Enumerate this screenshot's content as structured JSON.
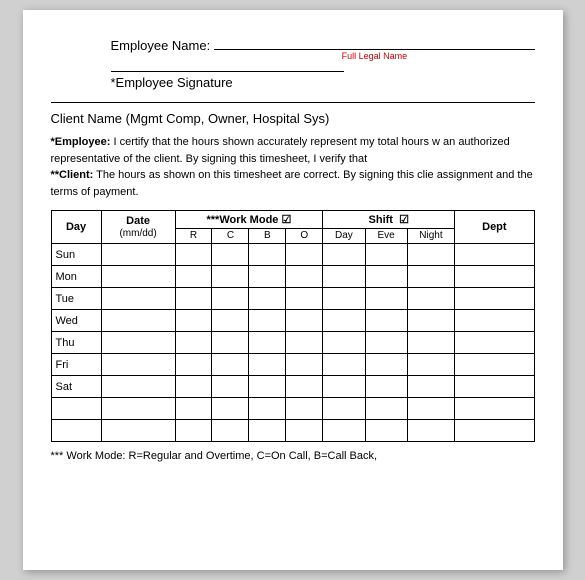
{
  "header": {
    "employee_name_label": "Employee Name:",
    "full_legal_name": "Full Legal Name",
    "employee_signature_label": "*Employee Signature",
    "client_name": "Client Name (Mgmt Comp, Owner, Hospital Sys)"
  },
  "cert_text": {
    "employee_line": "*Employee:  I certify that the hours shown accurately represent my total hours w an authorized representative of the client. By signing this timesheet, I verify that",
    "client_line": "**Client:  The hours as shown on this timesheet are correct.  By signing this clie assignment and the terms of payment."
  },
  "table": {
    "headers": {
      "day": "Day",
      "date": "Date\n(mm/dd)",
      "work_mode": "***Work Mode",
      "work_mode_cols": [
        "R",
        "C",
        "B",
        "O"
      ],
      "shift": "Shift",
      "shift_cols": [
        "Day",
        "Eve",
        "Night"
      ],
      "dept": "Dept"
    },
    "rows": [
      {
        "day": "Sun"
      },
      {
        "day": "Mon"
      },
      {
        "day": "Tue"
      },
      {
        "day": "Wed"
      },
      {
        "day": "Thu"
      },
      {
        "day": "Fri"
      },
      {
        "day": "Sat"
      },
      {
        "day": ""
      },
      {
        "day": ""
      }
    ]
  },
  "footnote": "*** Work Mode: R=Regular and Overtime, C=On Call, B=Call Back,"
}
